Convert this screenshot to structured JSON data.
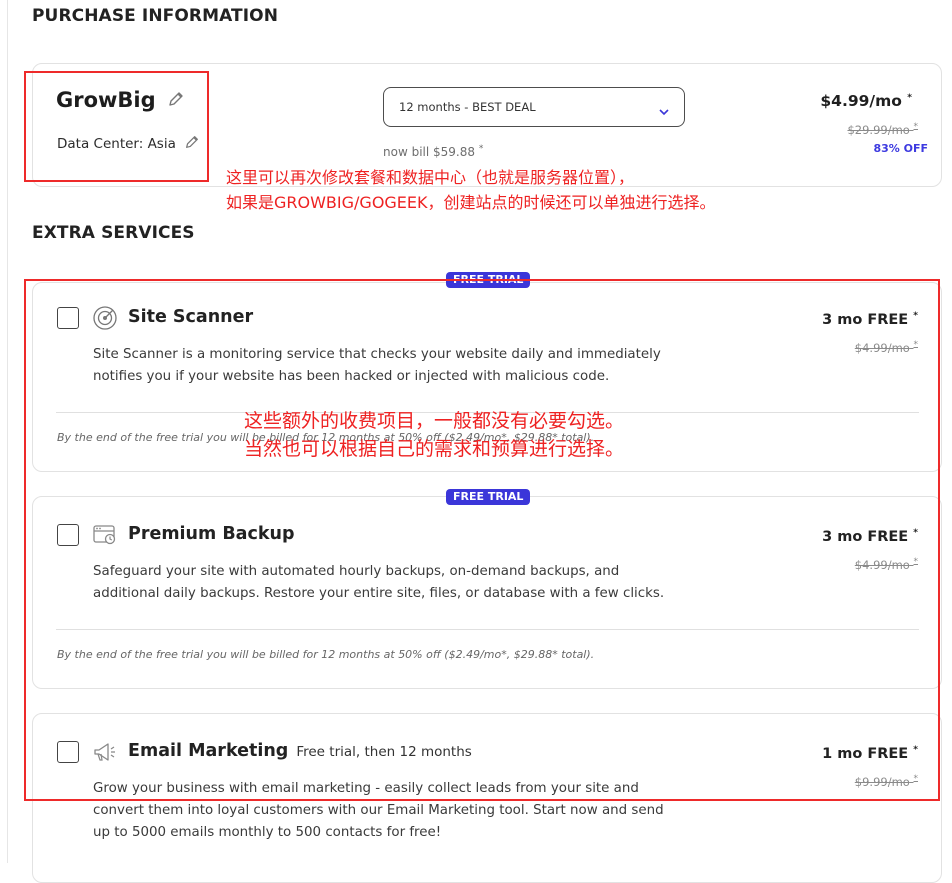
{
  "purchase": {
    "section_title": "PURCHASE INFORMATION",
    "plan_name": "GrowBig",
    "data_center": "Data Center: Asia",
    "period_select": "12 months - BEST DEAL",
    "now_bill": "now bill $59.88",
    "price": "$4.99/mo",
    "old_price": "$29.99/mo",
    "discount": "83% OFF",
    "asterisk": "*"
  },
  "extra": {
    "section_title": "EXTRA SERVICES",
    "services": [
      {
        "badge": "FREE TRIAL",
        "name": "Site Scanner",
        "icon": "radar-icon",
        "description": "Site Scanner is a monitoring service that checks your website daily and immediately notifies you if your website has been hacked or injected with malicious code.",
        "trial_price": "3 mo FREE",
        "old_price": "$4.99/mo",
        "fine_print": "By the end of the free trial you will be billed for 12 months at 50% off ($2.49/mo*, $29.88* total).",
        "checked": false
      },
      {
        "badge": "FREE TRIAL",
        "name": "Premium Backup",
        "icon": "backup-icon",
        "description": "Safeguard your site with automated hourly backups, on-demand backups, and additional daily backups. Restore your entire site, files, or database with a few clicks.",
        "trial_price": "3 mo FREE",
        "old_price": "$4.99/mo",
        "fine_print": "By the end of the free trial you will be billed for 12 months at 50% off ($2.49/mo*, $29.88* total).",
        "checked": false
      },
      {
        "name": "Email Marketing",
        "subtitle": "Free trial, then 12 months",
        "icon": "megaphone-icon",
        "description": "Grow your business with email marketing - easily collect leads from your site and convert them into loyal customers with our Email Marketing tool. Start now and send up to 5000 emails monthly to 500 contacts for free!",
        "trial_price": "1 mo FREE",
        "old_price": "$9.99/mo",
        "checked": false
      }
    ]
  },
  "annotations": {
    "note1_line1": "这里可以再次修改套餐和数据中心（也就是服务器位置），",
    "note1_line2": "如果是GROWBIG/GOGEEK，创建站点的时候还可以单独进行选择。",
    "note2_line1": "这些额外的收费项目，一般都没有必要勾选。",
    "note2_line2": "当然也可以根据自己的需求和预算进行选择。"
  },
  "colors": {
    "accent": "#3b36d9",
    "annotation_red": "#ee2222"
  }
}
